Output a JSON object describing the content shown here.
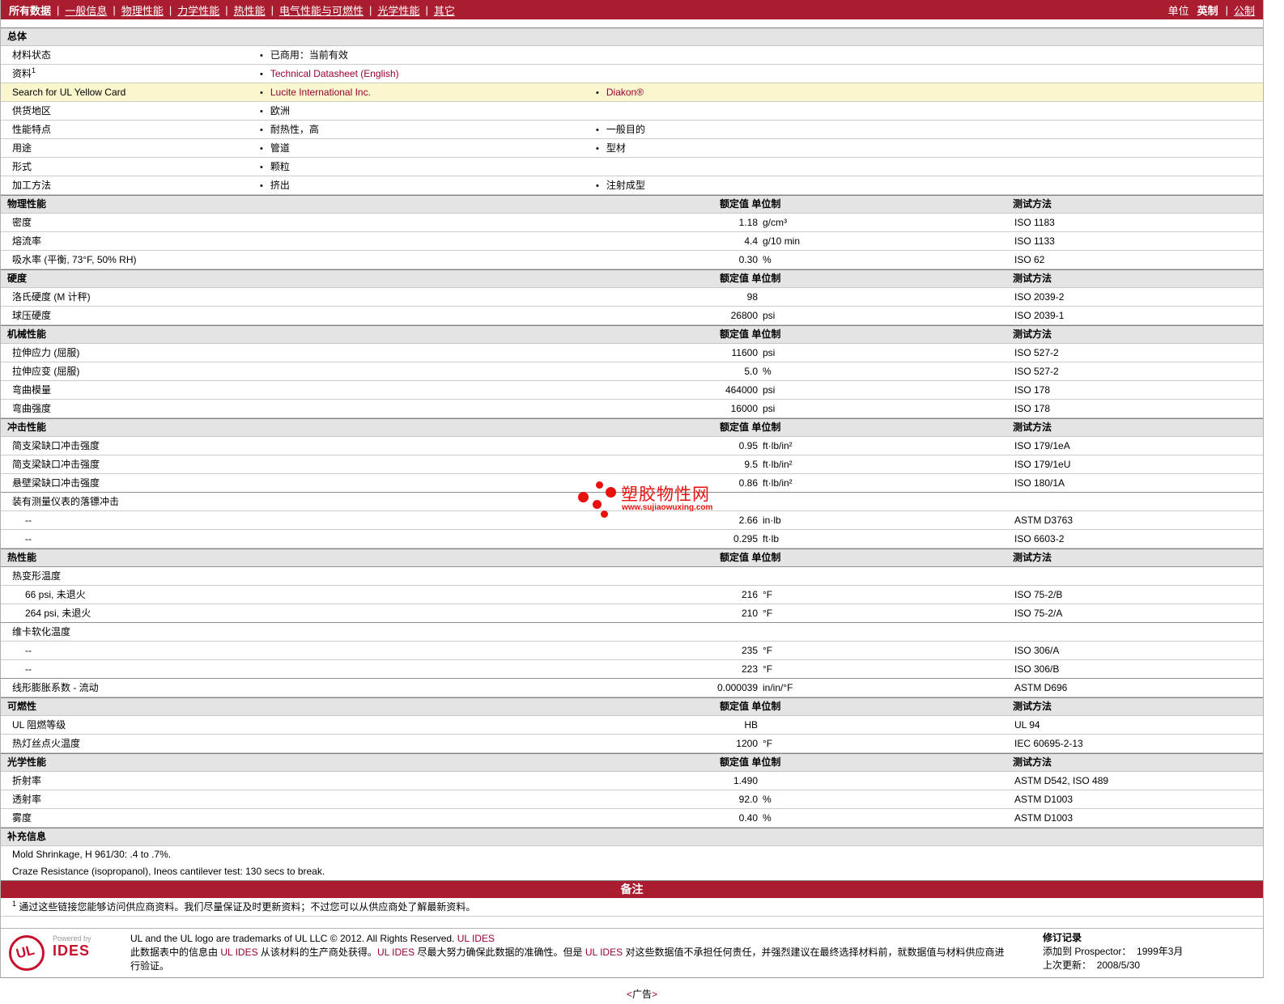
{
  "colors": {
    "accent": "#AA1C30",
    "link_red": "#990033",
    "highlight_row": "#FAF7CE",
    "watermark_red": "#E8110D"
  },
  "nav": {
    "items": [
      "所有数据",
      "一般信息",
      "物理性能",
      "力学性能",
      "热性能",
      "电气性能与可燃性",
      "光学性能",
      "其它"
    ],
    "units_label": "单位",
    "unit_english": "英制",
    "unit_metric": "公制"
  },
  "col_headers": {
    "value": "额定值 单位制",
    "method": "测试方法"
  },
  "general": {
    "title": "总体",
    "rows": [
      {
        "label": "材料状态",
        "items": [
          "已商用：当前有效"
        ]
      },
      {
        "label": "资料",
        "sup": "1",
        "items": [
          "Technical Datasheet (English)"
        ]
      },
      {
        "label": "Search for UL Yellow Card",
        "items": [
          "Lucite International Inc.",
          "Diakon®"
        ]
      },
      {
        "label": "供货地区",
        "items": [
          "欧洲"
        ]
      },
      {
        "label": "性能特点",
        "items": [
          "耐热性，高",
          "一般目的"
        ]
      },
      {
        "label": "用途",
        "items": [
          "管道",
          "型材"
        ]
      },
      {
        "label": "形式",
        "items": [
          "颗粒"
        ]
      },
      {
        "label": "加工方法",
        "items": [
          "挤出",
          "注射成型"
        ]
      }
    ]
  },
  "physical": {
    "title": "物理性能",
    "rows": [
      {
        "label": "密度",
        "value": "1.18",
        "unit": "g/cm³",
        "method": "ISO 1183"
      },
      {
        "label": "熔流率",
        "value": "4.4",
        "unit": "g/10 min",
        "method": "ISO 1133"
      },
      {
        "label": "吸水率 (平衡, 73°F, 50% RH)",
        "value": "0.30",
        "unit": "%",
        "method": "ISO 62"
      }
    ]
  },
  "hardness": {
    "title": "硬度",
    "rows": [
      {
        "label": "洛氏硬度 (M 计秤)",
        "value": "98",
        "unit": "",
        "method": "ISO 2039-2"
      },
      {
        "label": "球压硬度",
        "value": "26800",
        "unit": "psi",
        "method": "ISO 2039-1"
      }
    ]
  },
  "mechanical": {
    "title": "机械性能",
    "rows": [
      {
        "label": "拉伸应力 (屈服)",
        "value": "11600",
        "unit": "psi",
        "method": "ISO 527-2"
      },
      {
        "label": "拉伸应变 (屈服)",
        "value": "5.0",
        "unit": "%",
        "method": "ISO 527-2"
      },
      {
        "label": "弯曲模量",
        "value": "464000",
        "unit": "psi",
        "method": "ISO 178"
      },
      {
        "label": "弯曲强度",
        "value": "16000",
        "unit": "psi",
        "method": "ISO 178"
      }
    ]
  },
  "impact": {
    "title": "冲击性能",
    "rows": [
      {
        "label": "简支梁缺口冲击强度",
        "value": "0.95",
        "unit": "ft·lb/in²",
        "method": "ISO 179/1eA"
      },
      {
        "label": "简支梁缺口冲击强度",
        "value": "9.5",
        "unit": "ft·lb/in²",
        "method": "ISO 179/1eU"
      },
      {
        "label": "悬壁梁缺口冲击强度",
        "value": "0.86",
        "unit": "ft·lb/in²",
        "method": "ISO 180/1A"
      },
      {
        "label": "装有测量仪表的落镖冲击"
      },
      {
        "label": "--",
        "value": "2.66",
        "unit": "in·lb",
        "method": "ASTM D3763"
      },
      {
        "label": "--",
        "value": "0.295",
        "unit": "ft·lb",
        "method": "ISO 6603-2"
      }
    ]
  },
  "thermal": {
    "title": "热性能",
    "rows": [
      {
        "label": "热变形温度"
      },
      {
        "label": "66 psi, 未退火",
        "value": "216",
        "unit": "°F",
        "method": "ISO 75-2/B"
      },
      {
        "label": "264 psi, 未退火",
        "value": "210",
        "unit": "°F",
        "method": "ISO 75-2/A"
      },
      {
        "label": "维卡软化温度"
      },
      {
        "label": "--",
        "value": "235",
        "unit": "°F",
        "method": "ISO 306/A"
      },
      {
        "label": "--",
        "value": "223",
        "unit": "°F",
        "method": "ISO 306/B"
      },
      {
        "label": "线形膨胀系数  - 流动",
        "value": "0.000039",
        "unit": "in/in/°F",
        "method": "ASTM D696"
      }
    ]
  },
  "flammability": {
    "title": "可燃性",
    "rows": [
      {
        "label": "UL 阻燃等级",
        "value": "HB",
        "unit": "",
        "method": "UL 94"
      },
      {
        "label": "热灯丝点火温度",
        "value": "1200",
        "unit": "°F",
        "method": "IEC 60695-2-13"
      }
    ]
  },
  "optical": {
    "title": "光学性能",
    "rows": [
      {
        "label": "折射率",
        "value": "1.490",
        "unit": "",
        "method": "ASTM D542, ISO 489"
      },
      {
        "label": "透射率",
        "value": "92.0",
        "unit": "%",
        "method": "ASTM D1003"
      },
      {
        "label": "雾度",
        "value": "0.40",
        "unit": "%",
        "method": "ASTM D1003"
      }
    ]
  },
  "supplemental": {
    "title": "补充信息",
    "lines": [
      "Mold Shrinkage, H 961/30:  .4 to .7%.",
      "Craze Resistance (isopropanol), Ineos cantilever test:  130 secs to break."
    ]
  },
  "notes_bar": {
    "label": "备注"
  },
  "footnote": {
    "sup": "1",
    "text": " 通过这些链接您能够访问供应商资料。我们尽量保证及时更新资料；不过您可以从供应商处了解最新资料。"
  },
  "watermark": {
    "title": "塑胶物性网",
    "url": "www.sujiaowuxing.com"
  },
  "footer": {
    "logo_text": "UL",
    "powered_by": "Powered by",
    "brand": "IDES",
    "line1_text": "UL and the UL logo are trademarks of UL LLC © 2012. All Rights Reserved. ",
    "line1_link": "UL IDES",
    "line2_parts": [
      "此数据表中的信息由 ",
      "UL IDES",
      " 从该材料的生产商处获得。",
      "UL IDES",
      " 尽最大努力确保此数据的准确性。但是 ",
      "UL IDES",
      " 对这些数据值不承担任何责任，并强烈建议在最终选择材料前，就数据值与材料供应商进行验证。"
    ],
    "revision": {
      "title": "修订记录",
      "added_label": "添加到  Prospector：",
      "added_value": "1999年3月",
      "updated_label": "上次更新：",
      "updated_value": "2008/5/30"
    }
  },
  "ad": {
    "parts": [
      "<",
      "广告",
      ">"
    ]
  }
}
